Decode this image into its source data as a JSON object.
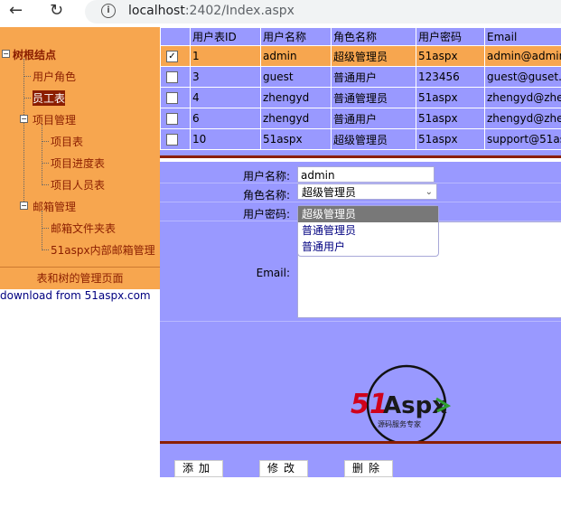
{
  "browser": {
    "back_icon": "arrow-left-icon",
    "reload_icon": "reload-icon",
    "info_icon": "info-icon",
    "url_host": "localhost",
    "url_path": ":2402/Index.aspx"
  },
  "tree": {
    "root": "树根结点",
    "items": {
      "user_role": "用户角色",
      "employee": "员工表",
      "project_mgmt": "项目管理",
      "project_table": "项目表",
      "project_progress": "项目进度表",
      "project_staff": "项目人员表",
      "mail_mgmt": "邮箱管理",
      "mail_folder": "邮箱文件夹表",
      "internal_mail": "51aspx内部邮箱管理"
    },
    "footer": "表和树的管理页面",
    "download": "download from 51aspx.com"
  },
  "grid": {
    "headers": [
      "",
      "用户表ID",
      "用户名称",
      "角色名称",
      "用户密码",
      "Email"
    ],
    "rows": [
      {
        "checked": true,
        "id": "1",
        "name": "admin",
        "role": "超级管理员",
        "password": "51aspx",
        "email": "admin@admin"
      },
      {
        "checked": false,
        "id": "3",
        "name": "guest",
        "role": "普通用户",
        "password": "123456",
        "email": "guest@guset.c"
      },
      {
        "checked": false,
        "id": "4",
        "name": "zhengyd",
        "role": "普通管理员",
        "password": "51aspx",
        "email": "zhengyd@zher"
      },
      {
        "checked": false,
        "id": "6",
        "name": "zhengyd",
        "role": "普通用户",
        "password": "51aspx",
        "email": "zhengyd@zher"
      },
      {
        "checked": false,
        "id": "10",
        "name": "51aspx",
        "role": "超级管理员",
        "password": "51aspx",
        "email": "support@51as"
      }
    ]
  },
  "form": {
    "username_label": "用户名称:",
    "username_value": "admin",
    "role_label": "角色名称:",
    "role_value": "超级管理员",
    "password_label": "用户密码:",
    "email_label": "Email:",
    "role_options": [
      "超级管理员",
      "普通管理员",
      "普通用户"
    ]
  },
  "logo": {
    "brand_51": "51",
    "brand_aspx": "Aspx",
    "tagline": "源码服务专家"
  },
  "buttons": {
    "add": "添加",
    "edit": "修改",
    "delete": "删除"
  },
  "colors": {
    "panel_orange": "#f7a64f",
    "grid_blue": "#9999ff",
    "dark_red": "#8b1e00"
  }
}
